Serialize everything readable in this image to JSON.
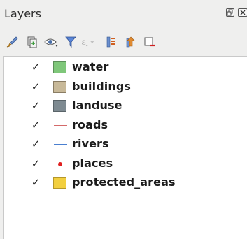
{
  "panel": {
    "title": "Layers",
    "float_label": "⊡",
    "close_label": "✕"
  },
  "toolbar": {
    "buttons": [
      {
        "name": "style-manager-button",
        "icon": "paintbrush-icon"
      },
      {
        "name": "add-group-button",
        "icon": "add-group-icon"
      },
      {
        "name": "visibility-button",
        "icon": "eye-icon"
      },
      {
        "name": "filter-legend-button",
        "icon": "funnel-icon"
      },
      {
        "name": "filter-expression-button",
        "icon": "expression-icon"
      },
      {
        "name": "expand-all-button",
        "icon": "expand-icon"
      },
      {
        "name": "collapse-all-button",
        "icon": "collapse-icon"
      },
      {
        "name": "remove-layer-button",
        "icon": "remove-layer-icon"
      }
    ]
  },
  "layers": [
    {
      "name": "water",
      "checked": true,
      "symbol": "fill",
      "color": "#7fc77a",
      "border": "#5c8f58"
    },
    {
      "name": "buildings",
      "checked": true,
      "symbol": "fill",
      "color": "#c8b999",
      "border": "#8a7d64"
    },
    {
      "name": "landuse",
      "checked": true,
      "symbol": "fill",
      "color": "#7e8a91",
      "border": "#5a6469",
      "underline": true
    },
    {
      "name": "roads",
      "checked": true,
      "symbol": "line",
      "color": "#d46a6a"
    },
    {
      "name": "rivers",
      "checked": true,
      "symbol": "line",
      "color": "#4a7fd0"
    },
    {
      "name": "places",
      "checked": true,
      "symbol": "point",
      "color": "#e02020"
    },
    {
      "name": "protected_areas",
      "checked": true,
      "symbol": "fill",
      "color": "#f2cf3f",
      "border": "#b5972a"
    }
  ],
  "checkmark": "✓"
}
